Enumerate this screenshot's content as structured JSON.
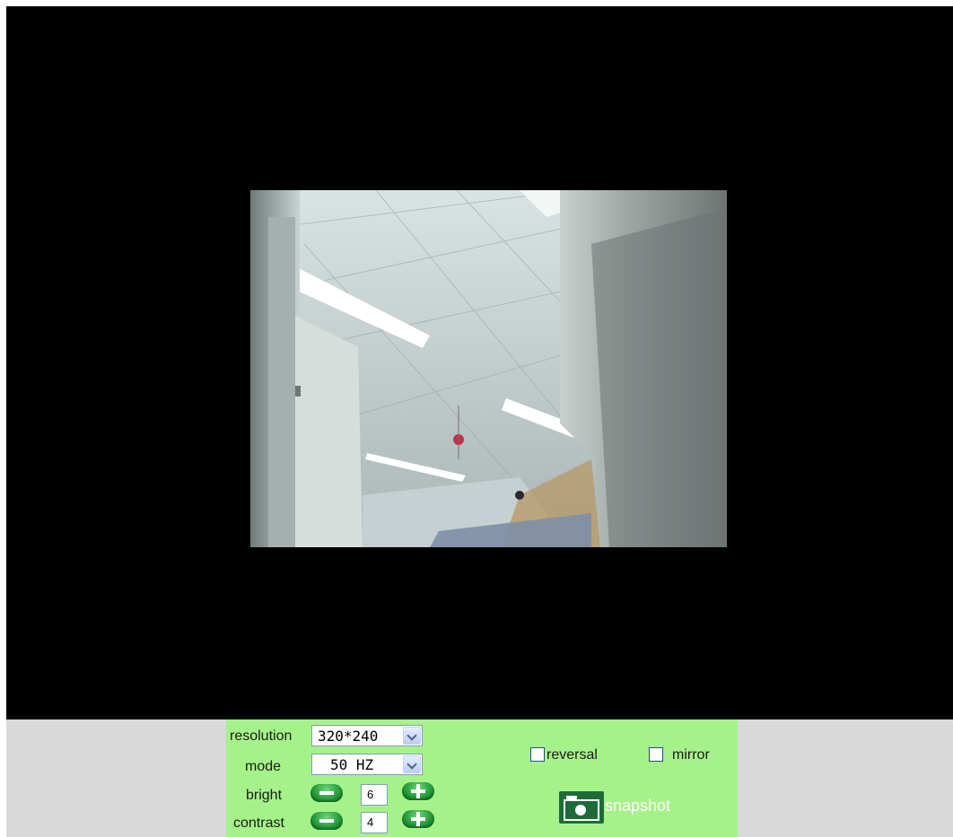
{
  "video": {
    "description_icon": "camera-feed"
  },
  "controls": {
    "resolution": {
      "label": "resolution",
      "value": "320*240"
    },
    "mode": {
      "label": "mode",
      "value": "50 HZ"
    },
    "bright": {
      "label": "bright",
      "value": "6"
    },
    "contrast": {
      "label": "contrast",
      "value": "4"
    },
    "reversal": {
      "label": "reversal",
      "checked": false
    },
    "mirror": {
      "label": "mirror",
      "checked": false
    },
    "snapshot": {
      "label": "snapshot",
      "icon": "camera-icon"
    }
  },
  "colors": {
    "panel": "#a6f28a",
    "viewer": "#000000",
    "bar": "#d9d9d9",
    "button": "#198a2e"
  }
}
